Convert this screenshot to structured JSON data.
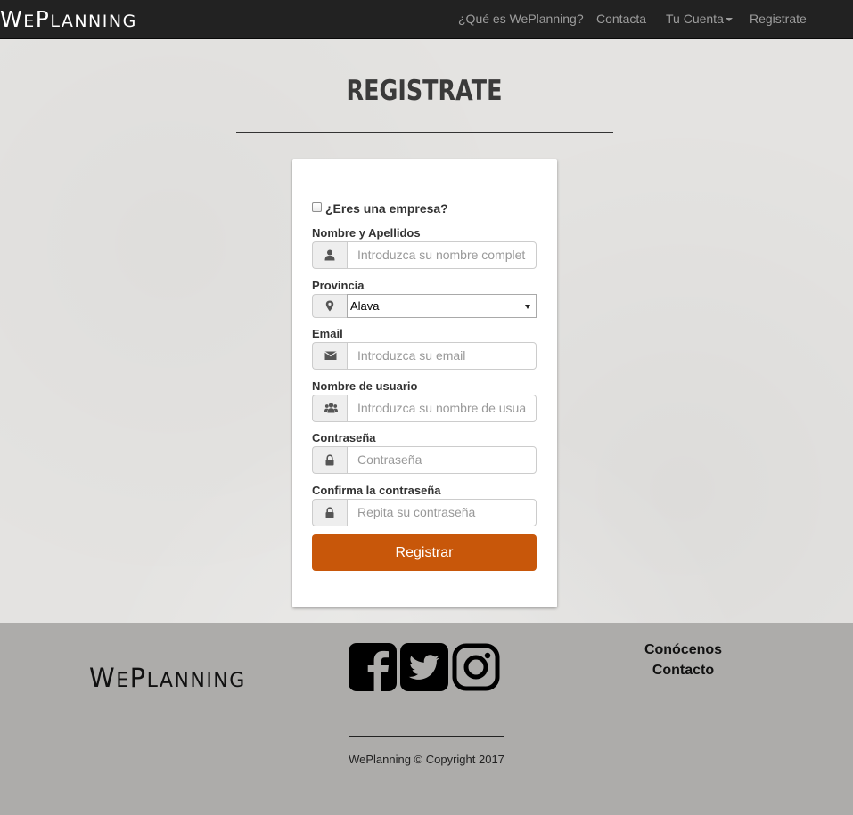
{
  "navbar": {
    "brand_text": "WePlanning",
    "links": {
      "about": "¿Qué es WePlanning?",
      "contact": "Contacta",
      "account": "Tu Cuenta",
      "register": "Registrate"
    }
  },
  "page": {
    "title": "REGISTRATE"
  },
  "form": {
    "company_checkbox": {
      "label": "¿Eres una empresa?",
      "checked": false
    },
    "fields": {
      "name": {
        "label": "Nombre y Apellidos",
        "placeholder": "Introduzca su nombre complet",
        "icon": "user-icon"
      },
      "province": {
        "label": "Provincia",
        "value": "Alava",
        "icon": "map-marker-icon"
      },
      "email": {
        "label": "Email",
        "placeholder": "Introduzca su email",
        "icon": "envelope-icon"
      },
      "username": {
        "label": "Nombre de usuario",
        "placeholder": "Introduzca su nombre de usua",
        "icon": "users-icon"
      },
      "password": {
        "label": "Contraseña",
        "placeholder": "Contraseña",
        "icon": "lock-icon"
      },
      "password_confirm": {
        "label": "Confirma la contraseña",
        "placeholder": "Repita su contraseña",
        "icon": "lock-icon"
      }
    },
    "submit_label": "Registrar"
  },
  "footer": {
    "brand_text": "WePlanning",
    "social": [
      "facebook-icon",
      "twitter-icon",
      "instagram-icon"
    ],
    "links": {
      "about": "Conócenos",
      "contact": "Contacto"
    },
    "copyright": "WePlanning © Copyright 2017"
  },
  "colors": {
    "navbar_bg": "#222222",
    "accent_button": "#c8570a",
    "footer_bg": "#adacaa"
  }
}
